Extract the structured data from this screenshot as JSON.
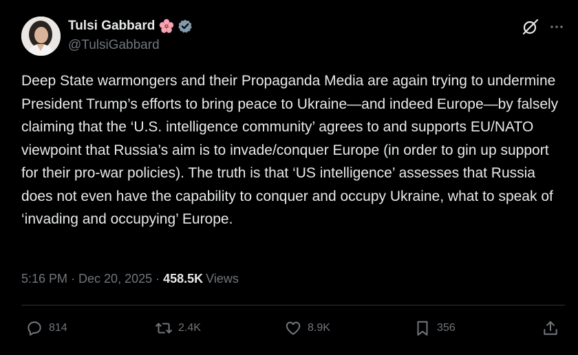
{
  "author": {
    "display_name": "Tulsi Gabbard",
    "handle": "@TulsiGabbard",
    "avatar_icon": "profile-photo",
    "name_emoji_icon": "hibiscus-flower-icon",
    "badge_icon": "verified-badge-icon"
  },
  "header_actions": {
    "grok_icon": "grok-icon",
    "more_icon": "more-dots-icon"
  },
  "post": {
    "text": "Deep State warmongers and their Propaganda Media are again trying to undermine President Trump’s efforts to bring peace to Ukraine—and indeed Europe—by falsely claiming that the ‘U.S. intelligence community’ agrees to and supports EU/NATO viewpoint that Russia’s aim is to invade/conquer Europe (in order to gin up support for their pro-war policies). The truth is that ‘US intelligence’ assesses that Russia does not even have the capability to conquer and occupy Ukraine, what to speak of ‘invading and occupying’ Europe."
  },
  "meta": {
    "timestamp": "5:16 PM · Dec 20, 2025",
    "separator": "·",
    "views_count": "458.5K",
    "views_label": "Views"
  },
  "actions": {
    "replies": "814",
    "reposts": "2.4K",
    "likes": "8.9K",
    "bookmarks": "356"
  },
  "colors": {
    "background": "#000000",
    "text_primary": "#e7e9ea",
    "text_secondary": "#71767b",
    "divider": "#2f3336",
    "verified": "#829aab",
    "flower": "#f4a5b8"
  }
}
